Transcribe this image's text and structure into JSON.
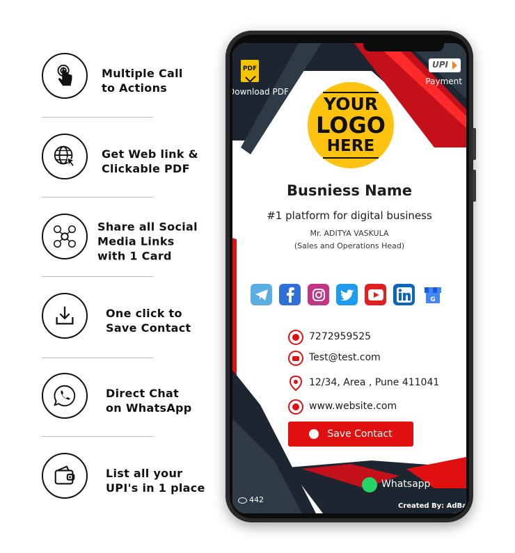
{
  "features": [
    {
      "icon": "touch-hand-icon",
      "lines": [
        "Multiple Call",
        "to Actions"
      ]
    },
    {
      "icon": "web-link-icon",
      "lines": [
        "Get Web link &",
        "Clickable PDF"
      ]
    },
    {
      "icon": "social-links-icon",
      "lines": [
        "Share all Social",
        "Media Links",
        "with 1 Card"
      ]
    },
    {
      "icon": "download-icon",
      "lines": [
        "One click to",
        "Save Contact"
      ]
    },
    {
      "icon": "whatsapp-icon",
      "lines": [
        "Direct Chat",
        "on WhatsApp"
      ]
    },
    {
      "icon": "wallet-icon",
      "lines": [
        "List all your",
        "UPI's in 1 place"
      ]
    }
  ],
  "card": {
    "download_pdf_label": "Download PDF",
    "pdf_badge": "PDF",
    "payment_label": "Payment",
    "upi_badge": "UPI",
    "logo_lines": [
      "YOUR",
      "LOGO",
      "HERE"
    ],
    "business_name": "Busniess Name",
    "tagline": "#1 platform for digital business",
    "person_name": "Mr. ADITYA VASKULA",
    "person_role": "(Sales and Operations Head)",
    "socials": [
      {
        "name": "telegram",
        "icon": "telegram-icon",
        "color": "#5aaee3"
      },
      {
        "name": "facebook",
        "icon": "facebook-icon",
        "color": "#2e6fd8"
      },
      {
        "name": "instagram",
        "icon": "instagram-icon",
        "color": "#c13584"
      },
      {
        "name": "twitter",
        "icon": "twitter-icon",
        "color": "#1d9bf0"
      },
      {
        "name": "youtube",
        "icon": "youtube-icon",
        "color": "#e02020"
      },
      {
        "name": "linkedin",
        "icon": "linkedin-icon",
        "color": "#0a66c2"
      },
      {
        "name": "google-business",
        "icon": "google-business-icon",
        "color": "#4285f4"
      }
    ],
    "phone": "7272959525",
    "email": "Test@test.com",
    "address": "12/34, Area , Pune 411041",
    "website": "www.website.com",
    "save_contact_label": "Save Contact",
    "whatsapp_label": "Whatsapp",
    "views": "442",
    "created_by": "Created By: AdBan"
  },
  "colors": {
    "accent": "#e01010",
    "dark": "#1c2530",
    "logo": "#ffc20e",
    "whatsapp": "#25d366"
  }
}
